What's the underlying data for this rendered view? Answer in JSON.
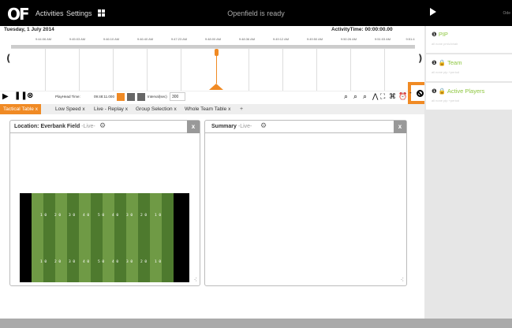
{
  "app": {
    "logo": "OF",
    "status": "Openfield is ready",
    "user": "Ode"
  },
  "nav": {
    "activities": "Activities",
    "settings": "Settings"
  },
  "timeline": {
    "date": "Tuesday, 1 July 2014",
    "activity_time": "ActivityTime: 00:00:00.00",
    "ticks": [
      "9:44:06 AM",
      "9:45:03 AM",
      "9:46:10 AM",
      "9:46:40 AM",
      "9:47:23 AM",
      "9:48:00 AM",
      "9:48:36 AM",
      "9:49:12 AM",
      "9:49:50 AM",
      "9:50:26 AM",
      "9:51:03 AM",
      "9:51:4"
    ],
    "left_arrow": "(",
    "right_arrow": ")"
  },
  "controls": {
    "playhead_label": "PlayHead Time:",
    "playhead_value": "09:48:11.000",
    "interval_label": "Interval(sec)",
    "interval_value": "300"
  },
  "tabs": [
    {
      "label": "Tactical Table",
      "active": true
    },
    {
      "label": "Low Speed",
      "active": false
    },
    {
      "label": "Live - Replay",
      "active": false
    },
    {
      "label": "Group Selection",
      "active": false
    },
    {
      "label": "Whole Team Table",
      "active": false
    }
  ],
  "tab_close": "x",
  "tab_add": "+",
  "panels": {
    "location": {
      "title": "Location: Everbank Field",
      "live": "-Live-",
      "close": "x"
    },
    "summary": {
      "title": "Summary",
      "live": "-Live-",
      "close": "x"
    }
  },
  "field": {
    "yard_labels_top": [
      "1 0",
      "2 0",
      "3 0",
      "4 0",
      "5 0",
      "4 0",
      "3 0",
      "2 0",
      "1 0"
    ],
    "yard_labels_bottom": [
      "1 0",
      "2 0",
      "3 0",
      "4 0",
      "5 0",
      "4 0",
      "3 0",
      "2 0",
      "1 0"
    ],
    "colors": {
      "endzone": "#111111",
      "light": "#6f9a45",
      "dark": "#4e7a2e"
    }
  },
  "sidebar": {
    "groups": [
      {
        "name": "PIP",
        "sub": "all  none  pmlc/chair"
      },
      {
        "name": "Team",
        "sub": "all  none  pip  +period"
      },
      {
        "name": "Active Players",
        "sub": "all  none  pip  +period"
      }
    ]
  },
  "colors": {
    "accent": "#f08a24",
    "green": "#8dc63f"
  }
}
